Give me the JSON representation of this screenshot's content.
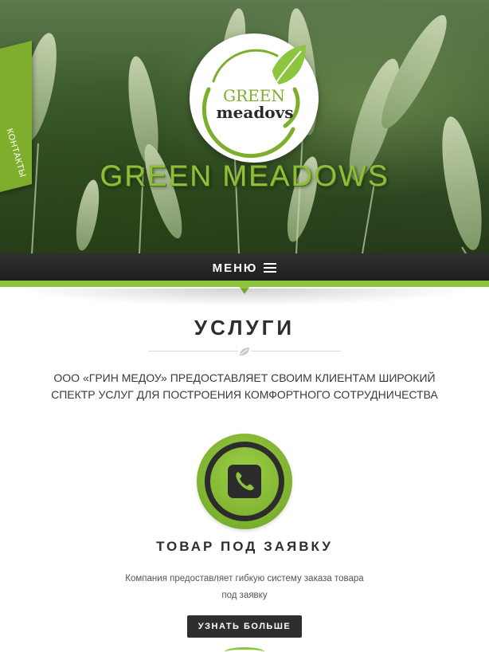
{
  "header": {
    "contact_tab": "КОНТАКТЫ",
    "logo": {
      "line1": "GREEN",
      "line2": "meadovs"
    },
    "brand_title": "GREEN MEADOWS"
  },
  "nav": {
    "menu_label": "МЕНЮ",
    "menu_icon": "hamburger-icon"
  },
  "services": {
    "title": "УСЛУГИ",
    "divider_icon": "leaf-icon",
    "intro": "ООО «ГРИН МЕДОУ» ПРЕДОСТАВЛЯЕТ СВОИМ КЛИЕНТАМ ШИРОКИЙ СПЕКТР УСЛУГ ДЛЯ ПОСТРОЕНИЯ КОМФОРТНОГО СОТРУДНИЧЕСТВА",
    "item": {
      "icon": "phone-icon",
      "title": "ТОВАР ПОД ЗАЯВКУ",
      "description": "Компания предоставляет гибкую систему заказа товара под заявку",
      "button": "УЗНАТЬ БОЛЬШЕ"
    }
  },
  "colors": {
    "accent_green": "#8cc63f",
    "dark": "#2e2e2e",
    "menu_bar": "#222222"
  }
}
